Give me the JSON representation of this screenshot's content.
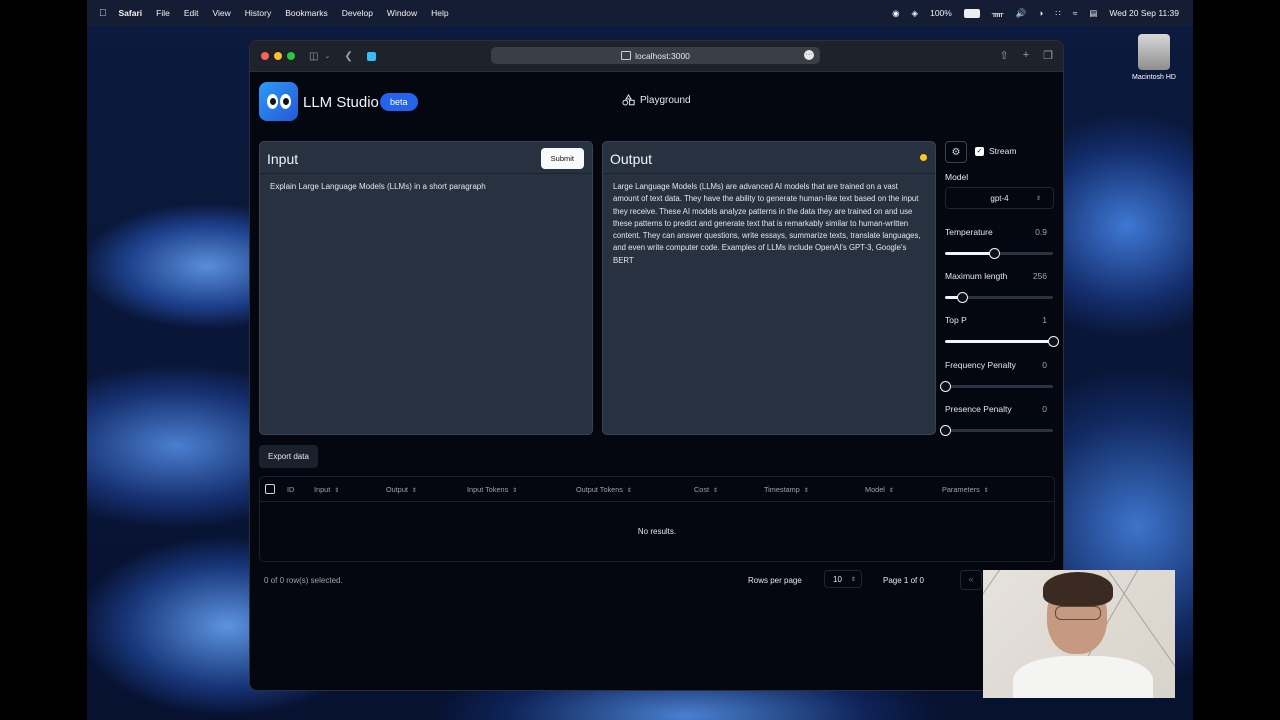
{
  "menubar": {
    "app": "Safari",
    "items": [
      "File",
      "Edit",
      "View",
      "History",
      "Bookmarks",
      "Develop",
      "Window",
      "Help"
    ],
    "battery": "100%",
    "datetime": "Wed 20 Sep  11:39"
  },
  "desktop": {
    "disk_label": "Macintosh HD"
  },
  "browser": {
    "url": "localhost:3000"
  },
  "app": {
    "name": "LLM Studio",
    "badge": "beta",
    "nav_label": "Playground"
  },
  "input_panel": {
    "title": "Input",
    "submit_label": "Submit",
    "text": "Explain Large Language Models (LLMs) in a short paragraph"
  },
  "output_panel": {
    "title": "Output",
    "status_color": "#facc15",
    "text": "Large Language Models (LLMs) are advanced AI models that are trained on a vast amount of text data. They have the ability to generate human-like text based on the input they receive. These AI models analyze patterns in the data they are trained on and use these patterns to predict and generate text that is remarkably similar to human-written content. They can answer questions, write essays, summarize texts, translate languages, and even write computer code. Examples of LLMs include OpenAI's GPT-3, Google's BERT"
  },
  "settings": {
    "stream_label": "Stream",
    "stream_checked": true,
    "model_label": "Model",
    "model_value": "gpt-4",
    "params": [
      {
        "label": "Temperature",
        "value": "0.9",
        "fraction": 0.45
      },
      {
        "label": "Maximum length",
        "value": "256",
        "fraction": 0.16
      },
      {
        "label": "Top P",
        "value": "1",
        "fraction": 1.0
      },
      {
        "label": "Frequency Penalty",
        "value": "0",
        "fraction": 0.0
      },
      {
        "label": "Presence Penalty",
        "value": "0",
        "fraction": 0.0
      }
    ]
  },
  "table": {
    "export_label": "Export data",
    "columns": [
      "ID",
      "Input",
      "Output",
      "Input Tokens",
      "Output Tokens",
      "Cost",
      "Timestamp",
      "Model",
      "Parameters"
    ],
    "empty_text": "No results.",
    "selected_text": "0 of 0 row(s) selected.",
    "rows_per_page_label": "Rows per page",
    "rows_per_page": "10",
    "page_text": "Page 1 of 0"
  }
}
